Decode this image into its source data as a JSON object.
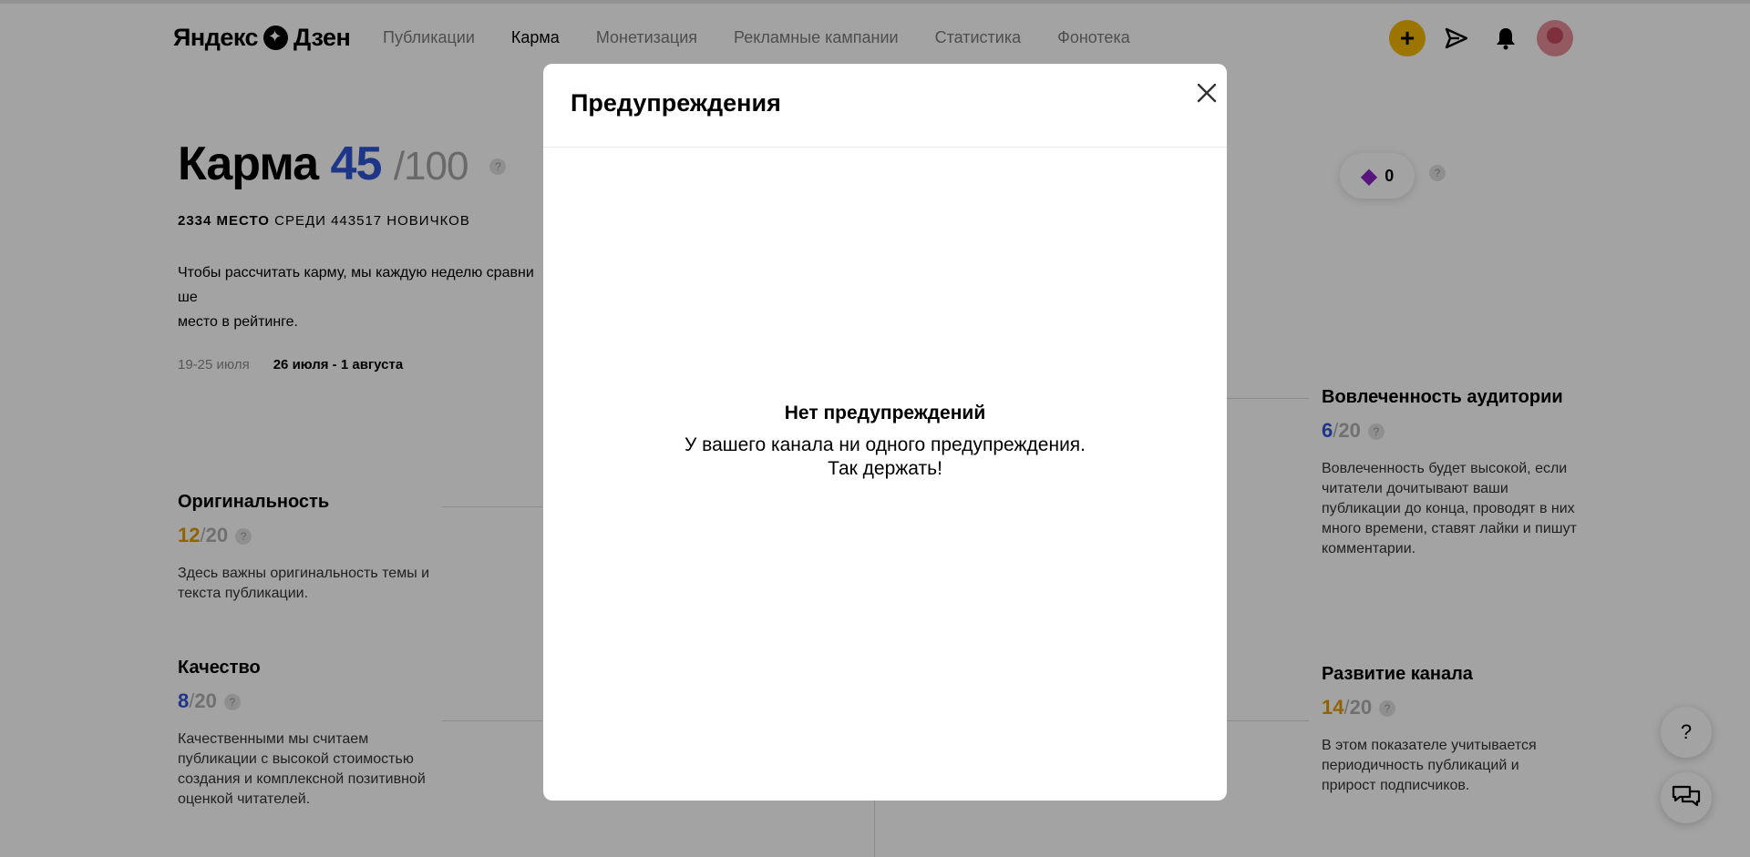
{
  "header": {
    "logo": "Яндекс Дзен",
    "nav": [
      "Публикации",
      "Карма",
      "Монетизация",
      "Рекламные кампании",
      "Статистика",
      "Фонотека"
    ],
    "active_nav": "Карма"
  },
  "karma": {
    "title": "Карма",
    "score": "45",
    "max": "/100",
    "rank_bold": "2334 МЕСТО",
    "rank_rest": "СРЕДИ 443517 НОВИЧКОВ",
    "description": "Чтобы рассчитать карму, мы каждую неделю сравни… ше место в рейтинге.",
    "description_left": "Чтобы рассчитать карму, мы каждую неделю сравни",
    "description_right": "ше",
    "description_line2": "место в рейтинге.",
    "period_prev": "19-25 июля",
    "period_current": "26 июля - 1 августа",
    "badge_value": "0"
  },
  "metrics": {
    "originality": {
      "name": "Оригинальность",
      "value": "12",
      "max": "20",
      "text": "Здесь важны оригинальность темы и текста публикации."
    },
    "quality": {
      "name": "Качество",
      "value": "8",
      "max": "20",
      "text": "Качественными мы считаем публикации с высокой стоимостью создания и комплексной позитивной оценкой читателей."
    },
    "engagement": {
      "name": "Вовлеченность аудитории",
      "value": "6",
      "max": "20",
      "text": "Вовлеченность будет высокой, если читатели дочитывают ваши публикации до конца, проводят в них много времени, ставят лайки и пишут комментарии."
    },
    "growth": {
      "name": "Развитие канала",
      "value": "14",
      "max": "20",
      "text": "В этом показателе учитывается периодичность публикаций и прирост подписчиков."
    }
  },
  "help_button": "?",
  "modal": {
    "title": "Предупреждения",
    "empty_title": "Нет предупреждений",
    "empty_line1": "У вашего канала ни одного предупреждения.",
    "empty_line2": "Так держать!"
  }
}
